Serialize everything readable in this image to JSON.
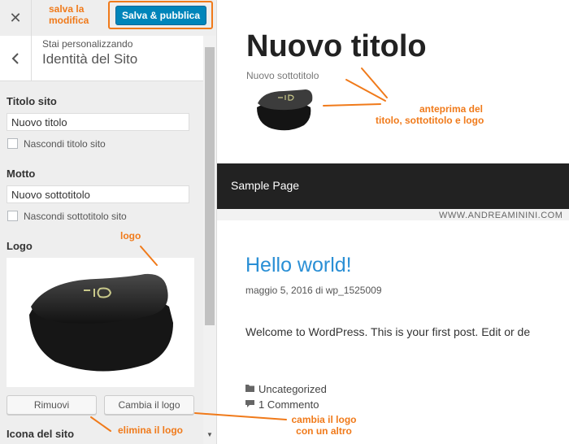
{
  "sidebar": {
    "save_label": "Salva & pubblica",
    "customizing_label": "Stai personalizzando",
    "section_title": "Identità del Sito",
    "site_title_label": "Titolo sito",
    "site_title_value": "Nuovo titolo",
    "hide_title_label": "Nascondi titolo sito",
    "tagline_label": "Motto",
    "tagline_value": "Nuovo sottotitolo",
    "hide_tagline_label": "Nascondi sottotitolo sito",
    "logo_label": "Logo",
    "remove_label": "Rimuovi",
    "change_logo_label": "Cambia il logo",
    "site_icon_label": "Icona del sito"
  },
  "preview": {
    "site_title": "Nuovo titolo",
    "tagline": "Nuovo sottotitolo",
    "nav_item": "Sample Page",
    "watermark": "WWW.ANDREAMININI.COM",
    "post_title": "Hello world!",
    "post_date": "maggio 5, 2016",
    "post_by": "di",
    "post_author": "wp_1525009",
    "post_body": "Welcome to WordPress. This is your first post. Edit or de",
    "category": "Uncategorized",
    "comments": "1 Commento"
  },
  "annotations": {
    "save_line1": "salva la",
    "save_line2": "modifica",
    "preview_line1": "anteprima del",
    "preview_line2": "titolo, sottotitolo e logo",
    "logo": "logo",
    "remove": "elimina il logo",
    "change_line1": "cambia il logo",
    "change_line2": "con un altro"
  },
  "icons": {
    "close": "close-icon",
    "back": "chevron-left-icon",
    "folder": "folder-icon",
    "comment": "comment-icon"
  },
  "colors": {
    "accent": "#0085ba",
    "annotation": "#f07a1a",
    "link": "#2a8fd5",
    "nav": "#222222"
  }
}
